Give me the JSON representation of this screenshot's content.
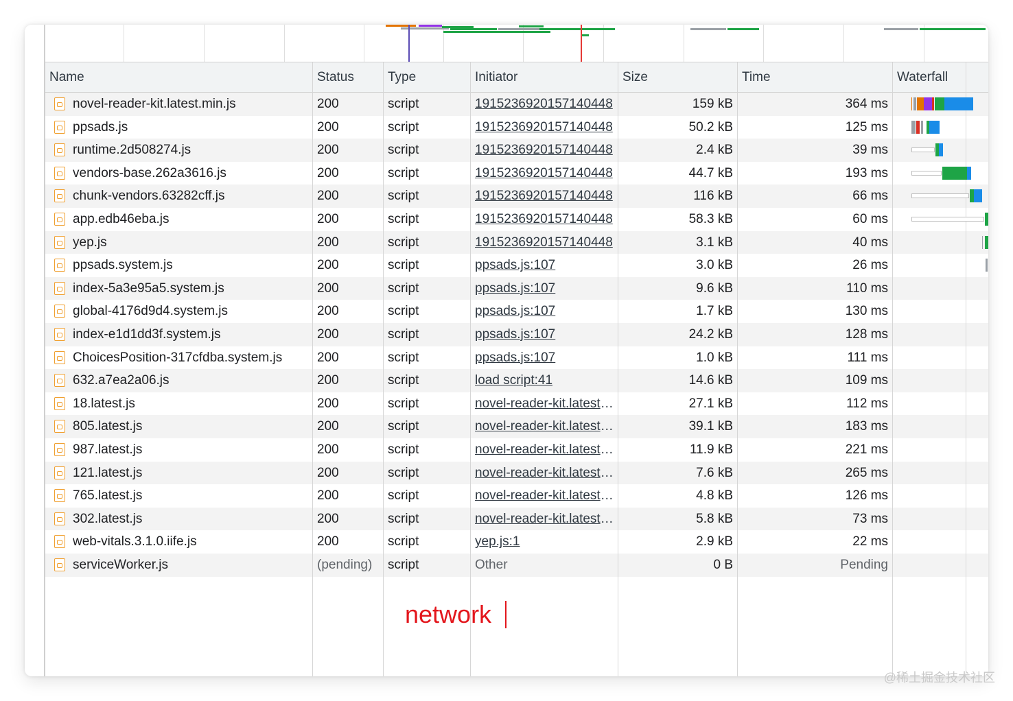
{
  "columns": {
    "name": "Name",
    "status": "Status",
    "type": "Type",
    "initiator": "Initiator",
    "size": "Size",
    "time": "Time",
    "waterfall": "Waterfall"
  },
  "rows": [
    {
      "name": "novel-reader-kit.latest.min.js",
      "status": "200",
      "type": "script",
      "initiator": "1915236920157140448",
      "initiator_style": "link",
      "size": "159 kB",
      "time": "364 ms"
    },
    {
      "name": "ppsads.js",
      "status": "200",
      "type": "script",
      "initiator": "1915236920157140448",
      "initiator_style": "link",
      "size": "50.2 kB",
      "time": "125 ms"
    },
    {
      "name": "runtime.2d508274.js",
      "status": "200",
      "type": "script",
      "initiator": "1915236920157140448",
      "initiator_style": "link",
      "size": "2.4 kB",
      "time": "39 ms"
    },
    {
      "name": "vendors-base.262a3616.js",
      "status": "200",
      "type": "script",
      "initiator": "1915236920157140448",
      "initiator_style": "link",
      "size": "44.7 kB",
      "time": "193 ms"
    },
    {
      "name": "chunk-vendors.63282cff.js",
      "status": "200",
      "type": "script",
      "initiator": "1915236920157140448",
      "initiator_style": "link",
      "size": "116 kB",
      "time": "66 ms"
    },
    {
      "name": "app.edb46eba.js",
      "status": "200",
      "type": "script",
      "initiator": "1915236920157140448",
      "initiator_style": "link",
      "size": "58.3 kB",
      "time": "60 ms"
    },
    {
      "name": "yep.js",
      "status": "200",
      "type": "script",
      "initiator": "1915236920157140448",
      "initiator_style": "link",
      "size": "3.1 kB",
      "time": "40 ms"
    },
    {
      "name": "ppsads.system.js",
      "status": "200",
      "type": "script",
      "initiator": "ppsads.js:107",
      "initiator_style": "link",
      "size": "3.0 kB",
      "time": "26 ms"
    },
    {
      "name": "index-5a3e95a5.system.js",
      "status": "200",
      "type": "script",
      "initiator": "ppsads.js:107",
      "initiator_style": "link",
      "size": "9.6 kB",
      "time": "110 ms"
    },
    {
      "name": "global-4176d9d4.system.js",
      "status": "200",
      "type": "script",
      "initiator": "ppsads.js:107",
      "initiator_style": "link",
      "size": "1.7 kB",
      "time": "130 ms"
    },
    {
      "name": "index-e1d1dd3f.system.js",
      "status": "200",
      "type": "script",
      "initiator": "ppsads.js:107",
      "initiator_style": "link",
      "size": "24.2 kB",
      "time": "128 ms"
    },
    {
      "name": "ChoicesPosition-317cfdba.system.js",
      "status": "200",
      "type": "script",
      "initiator": "ppsads.js:107",
      "initiator_style": "link",
      "size": "1.0 kB",
      "time": "111 ms"
    },
    {
      "name": "632.a7ea2a06.js",
      "status": "200",
      "type": "script",
      "initiator": "load script:41",
      "initiator_style": "link",
      "size": "14.6 kB",
      "time": "109 ms"
    },
    {
      "name": "18.latest.js",
      "status": "200",
      "type": "script",
      "initiator": "novel-reader-kit.latest.min.js",
      "initiator_style": "link",
      "size": "27.1 kB",
      "time": "112 ms"
    },
    {
      "name": "805.latest.js",
      "status": "200",
      "type": "script",
      "initiator": "novel-reader-kit.latest.min.js",
      "initiator_style": "link",
      "size": "39.1 kB",
      "time": "183 ms"
    },
    {
      "name": "987.latest.js",
      "status": "200",
      "type": "script",
      "initiator": "novel-reader-kit.latest.min.js",
      "initiator_style": "link",
      "size": "11.9 kB",
      "time": "221 ms"
    },
    {
      "name": "121.latest.js",
      "status": "200",
      "type": "script",
      "initiator": "novel-reader-kit.latest.min.js",
      "initiator_style": "link",
      "size": "7.6 kB",
      "time": "265 ms"
    },
    {
      "name": "765.latest.js",
      "status": "200",
      "type": "script",
      "initiator": "novel-reader-kit.latest.min.js",
      "initiator_style": "link",
      "size": "4.8 kB",
      "time": "126 ms"
    },
    {
      "name": "302.latest.js",
      "status": "200",
      "type": "script",
      "initiator": "novel-reader-kit.latest.min.js",
      "initiator_style": "link",
      "size": "5.8 kB",
      "time": "73 ms"
    },
    {
      "name": "web-vitals.3.1.0.iife.js",
      "status": "200",
      "type": "script",
      "initiator": "yep.js:1",
      "initiator_style": "link",
      "size": "2.9 kB",
      "time": "22 ms"
    },
    {
      "name": "serviceWorker.js",
      "status": "(pending)",
      "type": "script",
      "initiator": "Other",
      "initiator_style": "plain",
      "size": "0 B",
      "time": "Pending"
    }
  ],
  "overlay_caption": "network",
  "watermark": "@稀土掘金技术社区",
  "colors": {
    "waiting": "#9aa0a6",
    "ttfb_green": "#1ea446",
    "download_blue": "#1a8ce8",
    "orange": "#e37400",
    "purple": "#9334e6",
    "red": "#d93025",
    "dom_line": "#5b4cb5",
    "load_line": "#e53935",
    "caption_red": "#e3161c"
  }
}
